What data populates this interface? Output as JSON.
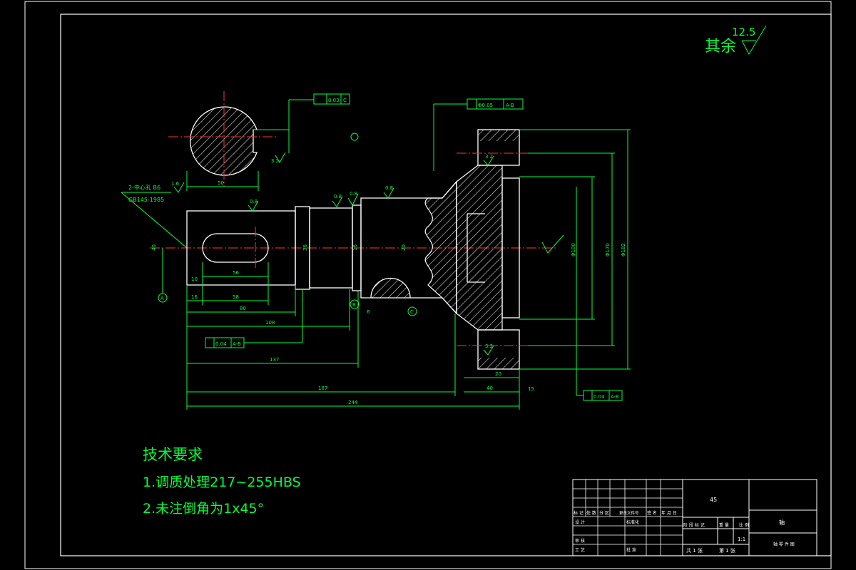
{
  "drawing": {
    "surface_note": {
      "label": "其余",
      "roughness": "12.5"
    },
    "tech_requirements": {
      "title": "技术要求",
      "item1": "1.调质处理217~255HBS",
      "item2": "2.未注倒角为1x45°"
    },
    "annotations": {
      "center_hole": "2-中心孔 B6",
      "center_hole_std": "GB145-1985",
      "dims": {
        "d50": "50",
        "d30": "30",
        "d58": "58",
        "d80": "80",
        "d56": "56",
        "d108": "108",
        "d137": "137",
        "d187": "187",
        "d244": "244",
        "d40": "40",
        "d20": "20",
        "d10": "10",
        "d16": "16",
        "d6": "6",
        "d15": "15",
        "d100": "Φ100",
        "d182": "Φ182",
        "d170": "Φ170",
        "d36": "36",
        "d16b": "16",
        "d3": "3.2",
        "d3b": "3.2",
        "r6": "0.8",
        "r6b": "0.8",
        "r6c": "0.8",
        "r6d": "0.8",
        "r6e": "1.6",
        "r6f": "3.2"
      },
      "tolerances": {
        "t1": "0.03",
        "t1_ref": "C",
        "t2": "Φ0.05",
        "t2_ref": "A-B",
        "t3": "0.04",
        "t3_ref": "A-B",
        "t4": "0.04",
        "t4_ref": "A-B"
      },
      "refs": {
        "a": "A",
        "b": "B",
        "c": "C"
      }
    }
  },
  "title_block": {
    "material": "45",
    "part_name": "轴",
    "scale": "1:1",
    "sheets_total": "共 1 张",
    "sheet_no": "第 1 张",
    "company": "",
    "row_labels": {
      "mark": "标 记",
      "count": "处 数",
      "zone": "分 区",
      "change_doc": "更改文件号",
      "signature": "签 名",
      "date": "年 月 日",
      "design": "设 计",
      "standardize": "标准化",
      "review": "审 核",
      "process": "工 艺",
      "approve": "批 准",
      "stage_mark": "阶 段 标 记",
      "weight": "重 量",
      "scale_label": "比 例"
    },
    "code": "轴 零 件 图"
  }
}
